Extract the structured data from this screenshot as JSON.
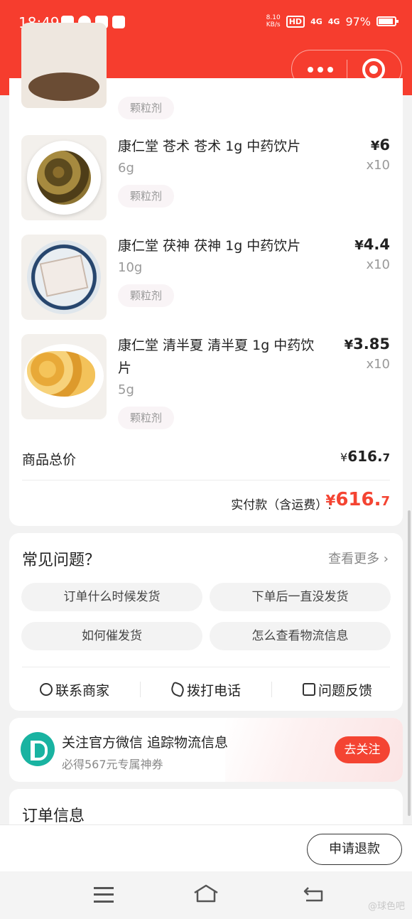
{
  "status_bar": {
    "time": "18:49",
    "net_speed": "8.10\nKB/s",
    "hd": "HD",
    "signal1": "4G",
    "signal2": "4G",
    "battery": "97%"
  },
  "nav": {
    "back_icon": "chevron-left-icon",
    "home_icon": "home-icon",
    "more_icon": "more-dots-icon",
    "close_icon": "target-circle-icon"
  },
  "goods": {
    "partial_tag": "颗粒剂",
    "items": [
      {
        "name": "康仁堂 苍术 苍术 1g 中药饮片",
        "spec": "6g",
        "tag": "颗粒剂",
        "price_symbol": "¥",
        "price": "6",
        "qty": "x10"
      },
      {
        "name": "康仁堂 茯神 茯神 1g 中药饮片",
        "spec": "10g",
        "tag": "颗粒剂",
        "price_symbol": "¥",
        "price": "4.4",
        "qty": "x10"
      },
      {
        "name": "康仁堂 清半夏 清半夏 1g 中药饮片",
        "spec": "5g",
        "tag": "颗粒剂",
        "price_symbol": "¥",
        "price": "3.85",
        "qty": "x10"
      }
    ],
    "total_label": "商品总价",
    "total_symbol": "¥",
    "total_int": "616.",
    "total_dec": "7",
    "pay_label": "实付款（含运费）:",
    "pay_symbol": "¥",
    "pay_int": "616.",
    "pay_dec": "7"
  },
  "faq": {
    "title": "常见问题？",
    "more": "查看更多",
    "chips": [
      "订单什么时候发货",
      "下单后一直没发货",
      "如何催发货",
      "怎么查看物流信息"
    ],
    "actions": [
      "联系商家",
      "拨打电话",
      "问题反馈"
    ]
  },
  "wechat": {
    "title": "关注官方微信 追踪物流信息",
    "subtitle": "必得567元专属神券",
    "button": "去关注"
  },
  "order_info": {
    "title": "订单信息"
  },
  "bottom": {
    "refund": "申请退款"
  },
  "watermark": "@球色吧",
  "colors": {
    "brand": "#f63d2e",
    "price": "#f44432"
  }
}
